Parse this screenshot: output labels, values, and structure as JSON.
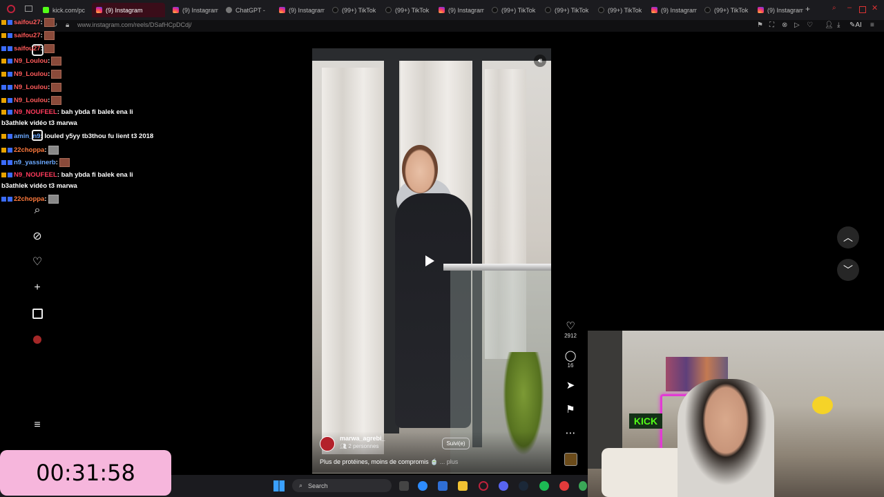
{
  "tabs": [
    {
      "title": "kick.com/pc",
      "icon": "kick-icon"
    },
    {
      "title": "(9) Instagram",
      "icon": "instagram-icon",
      "active": true
    },
    {
      "title": "(9) Instagram",
      "icon": "instagram-icon"
    },
    {
      "title": "ChatGPT -",
      "icon": "chatgpt-icon"
    },
    {
      "title": "(9) Instagram",
      "icon": "instagram-icon"
    },
    {
      "title": "(99+) TikTok",
      "icon": "tiktok-icon"
    },
    {
      "title": "(99+) TikTok",
      "icon": "tiktok-icon"
    },
    {
      "title": "(9) Instagram",
      "icon": "instagram-icon"
    },
    {
      "title": "(99+) TikTok",
      "icon": "tiktok-icon"
    },
    {
      "title": "(99+) TikTok",
      "icon": "tiktok-icon"
    },
    {
      "title": "(99+) TikTok",
      "icon": "tiktok-icon"
    },
    {
      "title": "(9) Instagram",
      "icon": "instagram-icon"
    },
    {
      "title": "(99+) TikTok",
      "icon": "tiktok-icon"
    },
    {
      "title": "(9) Instagram",
      "icon": "instagram-icon"
    }
  ],
  "address": {
    "url": "www.instagram.com/reels/DSafHCpDCdj/",
    "ai_label": "AI"
  },
  "chat": [
    {
      "user": "saifou27",
      "text": ":",
      "color": "#ff5a5a",
      "emote": true
    },
    {
      "user": "saifou27",
      "text": ":",
      "color": "#ff5a5a",
      "emote": true
    },
    {
      "user": "saifou27",
      "text": ":",
      "color": "#ff5a5a",
      "emote": true
    },
    {
      "user": "N9_Loulou",
      "text": ":",
      "color": "#ff5a5a",
      "emote": true
    },
    {
      "user": "N9_Loulou",
      "text": ":",
      "color": "#ff5a5a",
      "emote": true
    },
    {
      "user": "N9_Loulou",
      "text": ":",
      "color": "#ff5a5a",
      "emote": true
    },
    {
      "user": "N9_Loulou",
      "text": ":",
      "color": "#ff5a5a",
      "emote": true
    },
    {
      "user": "N9_NOUFEEL",
      "text": ": bah ybda fi balek ena li",
      "color": "#ff3b5c"
    },
    {
      "user": "",
      "text": "b3athlek vidéo t3 marwa",
      "color": "#ffffff"
    },
    {
      "user": "amin_n9",
      "text": ": louled y5yy tb3thou fu lient t3 2018",
      "color": "#6aa8ff"
    },
    {
      "user": "22choppa",
      "text": ":",
      "color": "#ff7a3d",
      "emote": true,
      "cat": true
    },
    {
      "user": "n9_yassinerb",
      "text": ":",
      "color": "#6aa8ff",
      "emote": true
    },
    {
      "user": "N9_NOUFEEL",
      "text": ": bah ybda fi balek ena li",
      "color": "#ff3b5c"
    },
    {
      "user": "",
      "text": "b3athlek vidéo t3 marwa",
      "color": "#ffffff"
    },
    {
      "user": "22choppa",
      "text": ":",
      "color": "#ff7a3d",
      "emote": true,
      "cat": true
    }
  ],
  "reel": {
    "username": "marwa_agrebi_",
    "followers": "2 personnes",
    "follow_label": "Suivi(e)",
    "caption": "Plus de protéines, moins de compromis",
    "more_label": "... plus",
    "likes": "2912",
    "comments": "16"
  },
  "webcam": {
    "logo_text": "KICK"
  },
  "timer": {
    "value": "00:31:58"
  },
  "taskbar": {
    "search_label": "Search"
  }
}
